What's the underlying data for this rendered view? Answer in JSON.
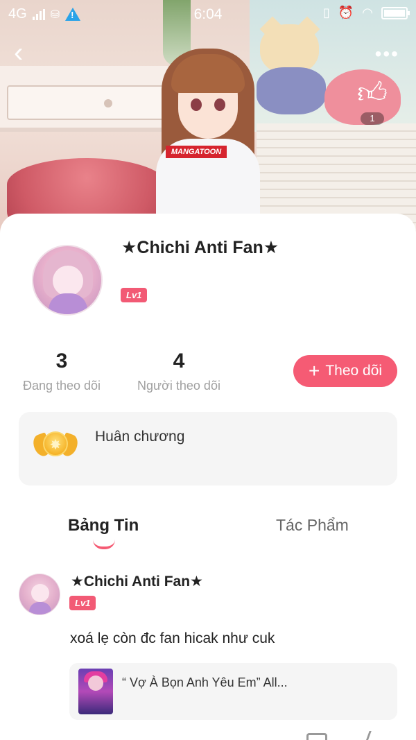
{
  "status_bar": {
    "network": "4G",
    "time": "6:04"
  },
  "hero": {
    "shirt_logo": "MANGATOON",
    "like_count": "1"
  },
  "profile": {
    "username": "★Chichi Anti Fan★",
    "level": "Lv1",
    "following_count": "3",
    "following_label": "Đang theo dõi",
    "followers_count": "4",
    "followers_label": "Người theo dõi",
    "follow_button_label": "Theo dõi",
    "medal_label": "Huân chương"
  },
  "tabs": [
    {
      "label": "Bảng Tin",
      "active": true
    },
    {
      "label": "Tác Phẩm",
      "active": false
    }
  ],
  "post": {
    "author": "★Chichi Anti Fan★",
    "level": "Lv1",
    "text": "xoá lẹ còn đc fan hicak như cuk",
    "linked_work_title": "“ Vợ À Bọn Anh Yêu Em” All..."
  },
  "colors": {
    "accent": "#f55b74",
    "level_badge": "#f25a75",
    "medal_gold": "#f6b52b",
    "card_background": "#f5f5f5"
  },
  "icons": {
    "back": "chevron-left-icon",
    "more": "more-dots-icon",
    "like": "thumbs-up-icon",
    "medal": "medal-icon",
    "comment": "comment-icon",
    "share": "share-icon"
  }
}
